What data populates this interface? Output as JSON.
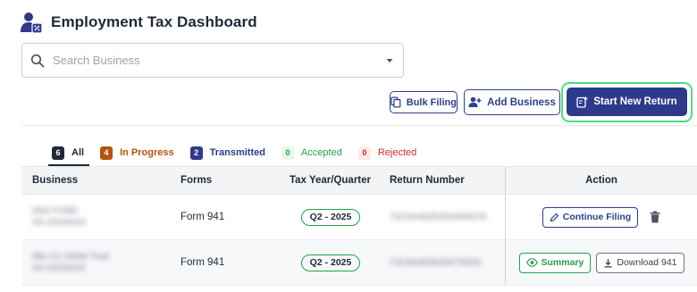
{
  "header": {
    "title": "Employment Tax Dashboard"
  },
  "search": {
    "placeholder": "Search Business"
  },
  "toolbar": {
    "bulk_label": "Bulk Filing",
    "add_label": "Add Business",
    "start_label": "Start New Return"
  },
  "tabs": [
    {
      "count": "6",
      "label": "All"
    },
    {
      "count": "4",
      "label": "In Progress"
    },
    {
      "count": "2",
      "label": "Transmitted"
    },
    {
      "count": "0",
      "label": "Accepted"
    },
    {
      "count": "0",
      "label": "Rejected"
    }
  ],
  "table": {
    "headers": {
      "business": "Business",
      "forms": "Forms",
      "tax": "Tax Year/Quarter",
      "return": "Return Number",
      "action": "Action"
    },
    "rows": [
      {
        "business_line1": "DD2 FUND",
        "business_line2": "XX-2XX0XX4",
        "form": "Form 941",
        "tax_period": "Q2 - 2025",
        "return_number": "T2C9X4025X5X8X9X78",
        "action_primary": "Continue Filing"
      },
      {
        "business_line1": "Abc Co Verba Trust",
        "business_line2": "XX-X2X9X20",
        "form": "Form 941",
        "tax_period": "Q2 - 2025",
        "return_number": "T2C9X4025X5X7X5X0",
        "action_primary": "Summary",
        "action_secondary": "Download 941"
      }
    ]
  },
  "colors": {
    "primary": "#2d3a8c",
    "success": "#22a052",
    "warning": "#b45309",
    "danger": "#dc2626",
    "highlight": "#4ade80"
  },
  "icons": {
    "app": "user-tax-icon",
    "search": "search-icon",
    "dropdown": "chevron-down-icon",
    "bulk": "copy-icon",
    "add": "add-user-icon",
    "start": "new-document-icon",
    "edit": "pencil-icon",
    "delete": "trash-icon",
    "view": "eye-icon",
    "download": "download-icon"
  }
}
